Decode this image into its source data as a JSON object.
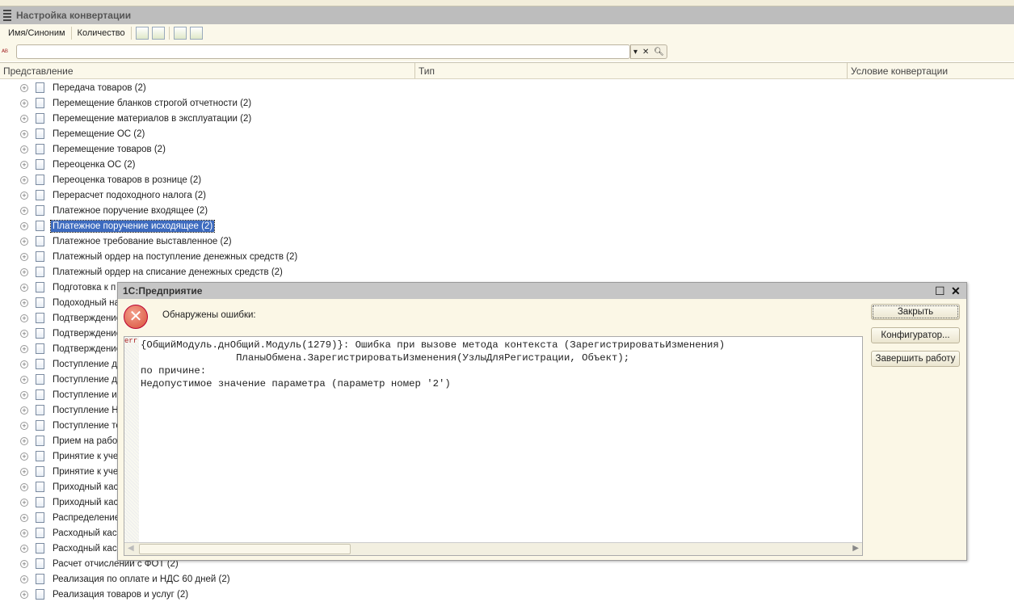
{
  "window": {
    "title": "Настройка конвертации"
  },
  "toolbar": {
    "name_synonym": "Имя/Синоним",
    "count": "Количество"
  },
  "search": {
    "value": "",
    "placeholder": ""
  },
  "columns": [
    "Представление",
    "Тип",
    "Условие конвертации"
  ],
  "rows": [
    "Передача товаров (2)",
    "Перемещение бланков строгой отчетности  (2)",
    "Перемещение материалов в эксплуатации (2)",
    "Перемещение ОС (2)",
    "Перемещение товаров (2)",
    "Переоценка ОС (2)",
    "Переоценка товаров в рознице (2)",
    "Перерасчет подоходного налога (2)",
    "Платежное поручение входящее (2)",
    "Платежное поручение исходящее (2)",
    "Платежное требование выставленное (2)",
    "Платежный ордер на поступление денежных средств (2)",
    "Платежный ордер на списание денежных средств (2)",
    "Подготовка к п",
    "Подоходный на",
    "Подтверждение",
    "Подтверждение",
    "Подтверждение",
    "Поступление де",
    "Поступление до",
    "Поступление из",
    "Поступление Н",
    "Поступление то",
    "Прием на работ",
    "Принятие к уче",
    "Принятие к уче",
    "Приходный кас",
    "Приходный кас",
    "Распределение",
    "Расходный кас",
    "Расходный кас",
    "Расчет отчислений с ФОТ (2)",
    "Реализация по оплате и НДС 60 дней (2)",
    "Реализация товаров и услуг (2)"
  ],
  "selected_row": 9,
  "dialog": {
    "title": "1С:Предприятие",
    "message": "Обнаружены ошибки:",
    "gutter": "err",
    "text": "{ОбщийМодуль.днОбщий.Модуль(1279)}: Ошибка при вызове метода контекста (ЗарегистрироватьИзменения)\n\t\tПланыОбмена.ЗарегистрироватьИзменения(УзлыДляРегистрации, Объект);\nпо причине:\nНедопустимое значение параметра (параметр номер '2')",
    "buttons": {
      "close": "Закрыть",
      "configurator": "Конфигуратор...",
      "exit": "Завершить работу"
    }
  }
}
